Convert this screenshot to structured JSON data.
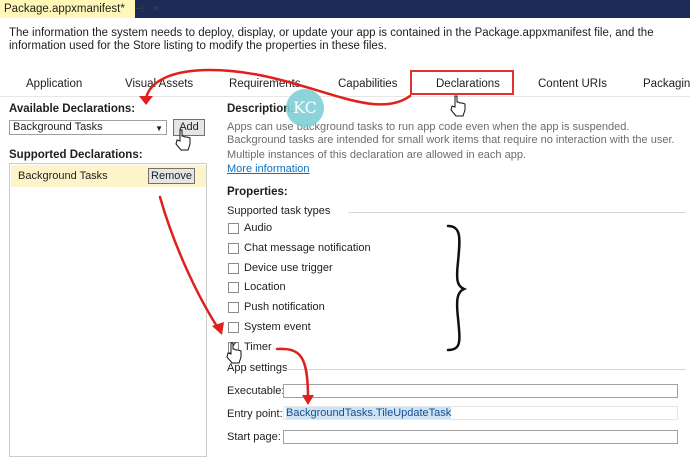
{
  "window": {
    "doc_tab_title": "Package.appxmanifest*",
    "pin_glyph": "⊣",
    "close_glyph": "×"
  },
  "info_text": "The information the system needs to deploy, display, or update your app is contained in the Package.appxmanifest file, and the information used for the Store listing to modify the properties in these files.",
  "tabs": [
    "Application",
    "Visual Assets",
    "Requirements",
    "Capabilities",
    "Declarations",
    "Content URIs",
    "Packaging"
  ],
  "active_tab": "Declarations",
  "left": {
    "available_label": "Available Declarations:",
    "combo_value": "Background Tasks",
    "add_label": "Add",
    "supported_label": "Supported Declarations:",
    "supported_items": [
      {
        "name": "Background Tasks",
        "remove_label": "Remove"
      }
    ]
  },
  "right": {
    "description_title": "Description:",
    "description_text": "Apps can use background tasks to run app code even when the app is suspended. Background tasks are intended for small work items that require no interaction with the user.",
    "multiple_text": "Multiple instances of this declaration are allowed in each app.",
    "more_info": "More information",
    "properties_title": "Properties:",
    "task_types_label": "Supported task types",
    "task_types": [
      {
        "label": "Audio",
        "checked": false
      },
      {
        "label": "Chat message notification",
        "checked": false
      },
      {
        "label": "Device use trigger",
        "checked": false
      },
      {
        "label": "Location",
        "checked": false
      },
      {
        "label": "Push notification",
        "checked": false
      },
      {
        "label": "System event",
        "checked": false
      },
      {
        "label": "Timer",
        "checked": true
      }
    ],
    "app_settings_label": "App settings",
    "executable_label": "Executable:",
    "executable_value": "",
    "entry_point_label": "Entry point:",
    "entry_point_value": "BackgroundTasks.TileUpdateTask",
    "start_page_label": "Start page:",
    "start_page_value": ""
  },
  "watermark": "KC",
  "colors": {
    "title_bar": "#1c2b55",
    "doc_tab": "#fff7b7",
    "highlight_box": "#e0322e",
    "annotation_arrow": "#e0201c",
    "selected_item": "#fdf5c9",
    "link": "#0e70c0",
    "watermark": "#7fd0d6"
  }
}
